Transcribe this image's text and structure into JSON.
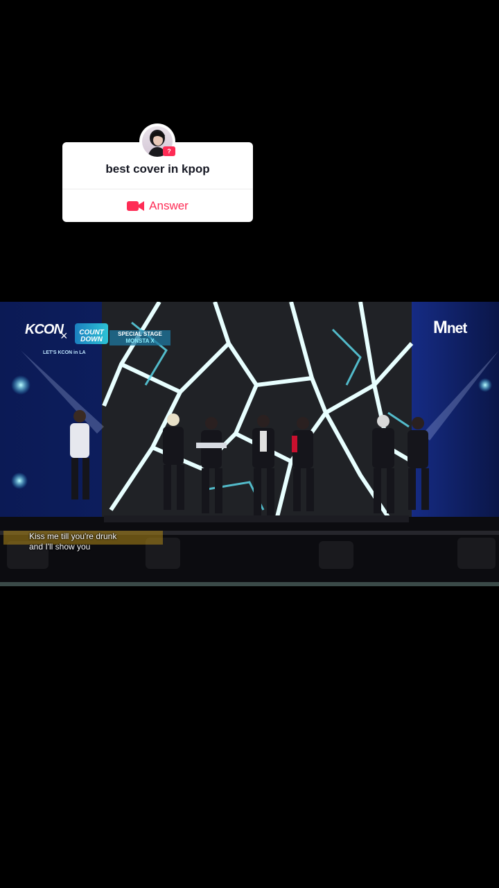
{
  "qa_sticker": {
    "question": "best cover in kpop",
    "answer_label": "Answer",
    "avatar_icon": "user-avatar",
    "badge_icon": "question-badge",
    "badge_text": "?",
    "camera_icon": "video-camera-icon",
    "accent_color": "#fe2c55"
  },
  "video": {
    "logos": {
      "kcon": "KCON",
      "kcon_sub": "LET'S KCON in LA",
      "times": "×",
      "countdown": "COUNT DOWN",
      "special_stage": "SPECIAL STAGE",
      "artist": "MONSTA X",
      "channel_m": "M",
      "channel_rest": "net"
    },
    "subtitle_line1": "Kiss me till you're drunk",
    "subtitle_line2": "and I'll show you"
  }
}
